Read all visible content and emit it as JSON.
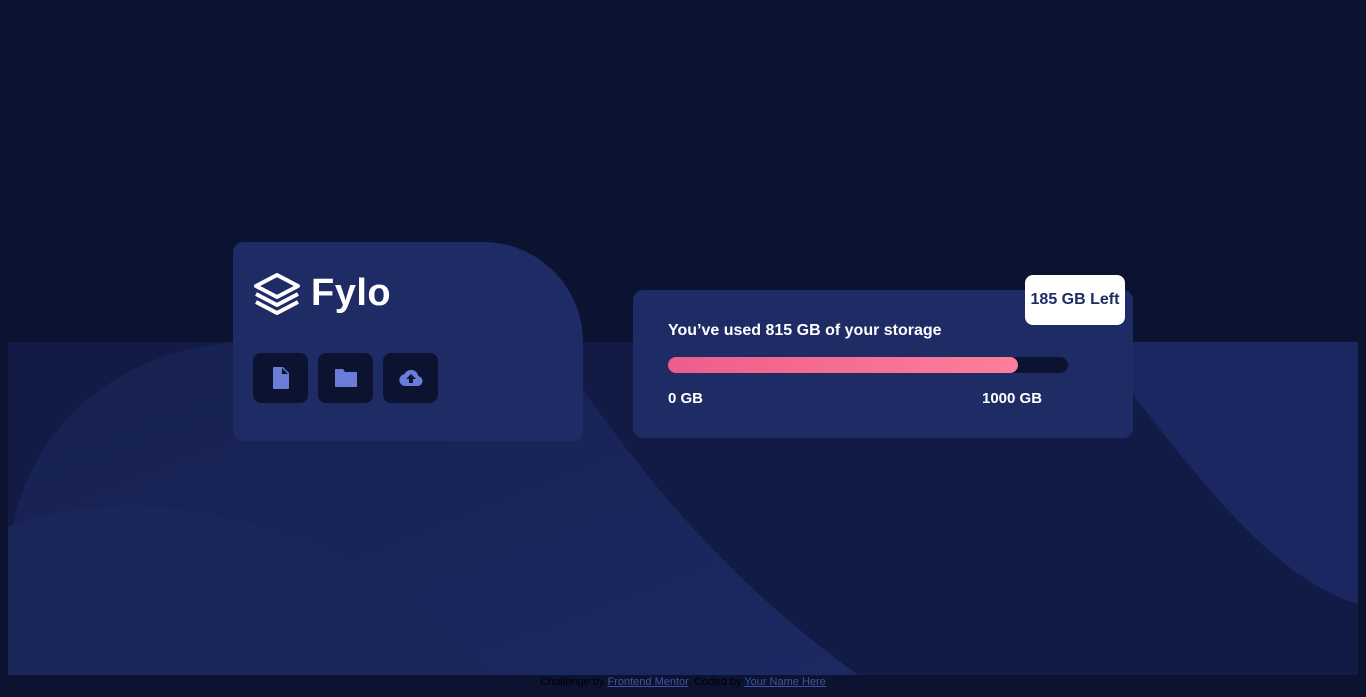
{
  "brand": {
    "name": "Fylo"
  },
  "toolbar": {
    "icons": [
      {
        "name": "file-icon"
      },
      {
        "name": "folder-icon"
      },
      {
        "name": "upload-icon"
      }
    ]
  },
  "storage": {
    "usage_text": "You’ve used 815 GB of your storage",
    "used_fraction": 0.875,
    "min_label": "0 GB",
    "max_label": "1000 GB",
    "left_badge": "185 GB Left"
  },
  "attribution": {
    "prefix": "Challenge by",
    "link1": "Frontend Mentor",
    "middle": ". Coded by",
    "link2": "Your Name Here"
  },
  "colors": {
    "background": "#0c1330",
    "card": "#1f2b65",
    "accent_start": "#ee5d8a",
    "accent_end": "#fc7f9a",
    "icon": "#6a7bd8"
  }
}
